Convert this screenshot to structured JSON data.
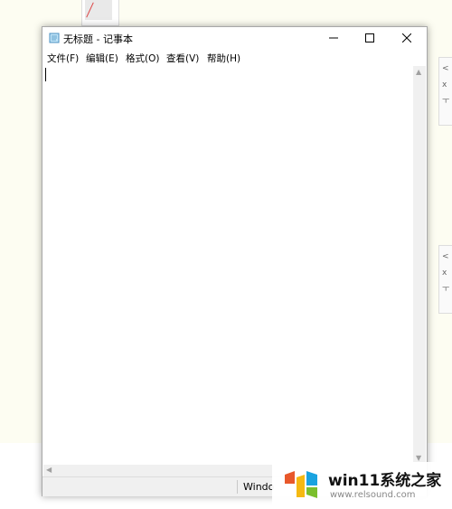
{
  "window": {
    "title": "无标题 - 记事本"
  },
  "menu": [
    {
      "label": "文件(F)"
    },
    {
      "label": "编辑(E)"
    },
    {
      "label": "格式(O)"
    },
    {
      "label": "查看(V)"
    },
    {
      "label": "帮助(H)"
    }
  ],
  "editor": {
    "text": ""
  },
  "statusbar": {
    "text": "Windo"
  },
  "background_cards": [
    {
      "chars": [
        "<",
        "x",
        "ㅜ"
      ]
    },
    {
      "chars": [
        "<",
        "x",
        "ㅜ"
      ]
    }
  ],
  "watermark": {
    "brand": "win11系统之家",
    "url": "www.relsound.com",
    "logo_colors": [
      "#e8582b",
      "#f5b912",
      "#1aa3e0",
      "#7bbf2c"
    ]
  }
}
